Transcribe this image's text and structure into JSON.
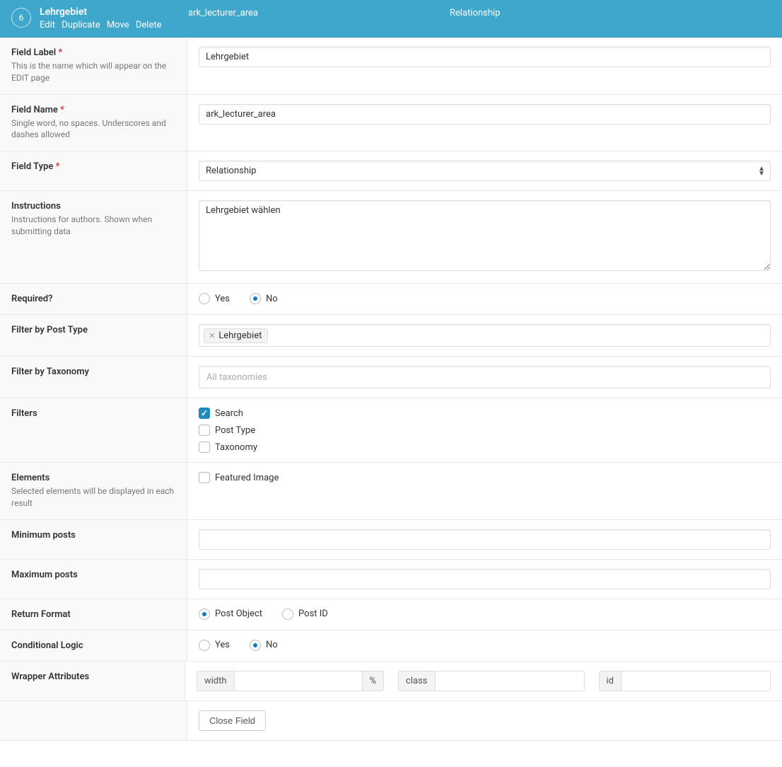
{
  "header": {
    "order": "6",
    "title": "Lehrgebiet",
    "name": "ark_lecturer_area",
    "type": "Relationship",
    "actions": {
      "edit": "Edit",
      "duplicate": "Duplicate",
      "move": "Move",
      "delete": "Delete"
    }
  },
  "labels": {
    "fieldLabel": "Field Label",
    "fieldLabelDesc": "This is the name which will appear on the EDIT page",
    "fieldName": "Field Name",
    "fieldNameDesc": "Single word, no spaces. Underscores and dashes allowed",
    "fieldType": "Field Type",
    "instructions": "Instructions",
    "instructionsDesc": "Instructions for authors. Shown when submitting data",
    "required": "Required?",
    "filterByPostType": "Filter by Post Type",
    "filterByTaxonomy": "Filter by Taxonomy",
    "filters": "Filters",
    "elements": "Elements",
    "elementsDesc": "Selected elements will be displayed in each result",
    "minPosts": "Minimum posts",
    "maxPosts": "Maximum posts",
    "returnFormat": "Return Format",
    "conditionalLogic": "Conditional Logic",
    "wrapperAttributes": "Wrapper Attributes"
  },
  "values": {
    "fieldLabel": "Lehrgebiet",
    "fieldName": "ark_lecturer_area",
    "fieldType": "Relationship",
    "instructions": "Lehrgebiet wählen",
    "requiredYes": "Yes",
    "requiredNo": "No",
    "postTypeTag": "Lehrgebiet",
    "taxonomyPlaceholder": "All taxonomies",
    "filterSearch": "Search",
    "filterPostType": "Post Type",
    "filterTaxonomy": "Taxonomy",
    "elementFeatured": "Featured Image",
    "minPosts": "",
    "maxPosts": "",
    "returnPostObject": "Post Object",
    "returnPostId": "Post ID",
    "condYes": "Yes",
    "condNo": "No",
    "wrapWidth": "width",
    "wrapPercent": "%",
    "wrapClass": "class",
    "wrapId": "id",
    "closeField": "Close Field"
  }
}
